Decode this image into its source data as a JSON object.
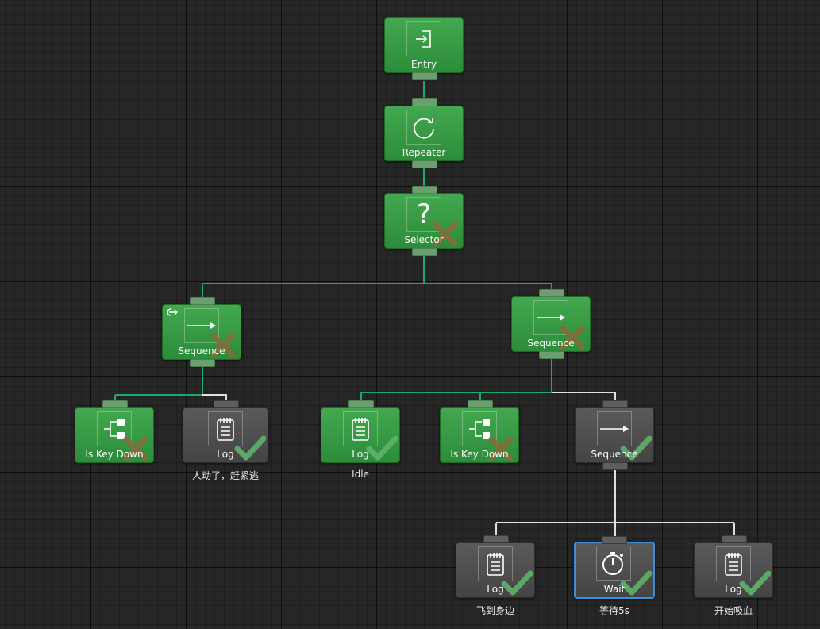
{
  "nodes": {
    "entry": {
      "label": "Entry",
      "icon": "entry-icon"
    },
    "repeater": {
      "label": "Repeater",
      "icon": "repeat-icon"
    },
    "selector": {
      "label": "Selector",
      "icon": "question-icon",
      "glyph": "?"
    },
    "seq_left": {
      "label": "Sequence",
      "icon": "arrow-right-icon"
    },
    "seq_right": {
      "label": "Sequence",
      "icon": "arrow-right-icon"
    },
    "iskey_left": {
      "label": "Is Key Down",
      "icon": "branch-icon"
    },
    "log_escape": {
      "label": "Log",
      "icon": "notepad-icon",
      "comment": "人动了，赶紧逃"
    },
    "log_idle": {
      "label": "Log",
      "icon": "notepad-icon",
      "comment": "Idle"
    },
    "iskey_right": {
      "label": "Is Key Down",
      "icon": "branch-icon"
    },
    "seq_bottom": {
      "label": "Sequence",
      "icon": "arrow-right-icon"
    },
    "log_fly": {
      "label": "Log",
      "icon": "notepad-icon",
      "comment": "飞到身边"
    },
    "wait": {
      "label": "Wait",
      "icon": "stopwatch-icon",
      "comment": "等待5s"
    },
    "log_drain": {
      "label": "Log",
      "icon": "notepad-icon",
      "comment": "开始吸血"
    }
  },
  "colors": {
    "running": "#2e8f3c",
    "idle": "#4b4b4b",
    "wire_active": "#1fa86a",
    "wire_inactive": "#e0e0e0",
    "selected": "#3d8fd9",
    "success": "#5fb36a",
    "failure": "#8a6a3a"
  }
}
